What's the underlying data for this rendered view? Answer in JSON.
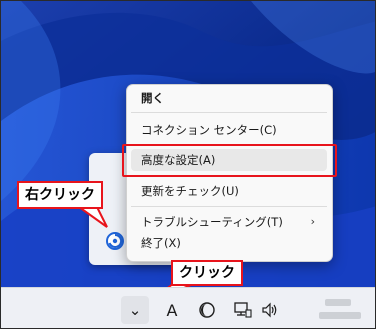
{
  "context_menu": {
    "items": [
      {
        "label": "開く",
        "bold": true
      },
      {
        "label": "コネクション センター(C)"
      },
      {
        "label": "高度な設定(A)",
        "highlighted": true
      },
      {
        "label": "更新をチェック(U)"
      },
      {
        "label": "トラブルシューティング(T)",
        "submenu_arrow": "›"
      },
      {
        "label": "終了(X)"
      }
    ]
  },
  "callouts": {
    "right_click": "右クリック",
    "click": "クリック"
  },
  "taskbar": {
    "chevron": "⌄",
    "ime_label": "A",
    "icons": [
      "chevron-up-icon",
      "ime-icon",
      "moon-icon",
      "network-icon",
      "speaker-icon"
    ]
  },
  "colors": {
    "accent_red": "#e8141c",
    "wallpaper_blue": "#0b2a7a",
    "menu_bg": "#f9f9f9"
  }
}
